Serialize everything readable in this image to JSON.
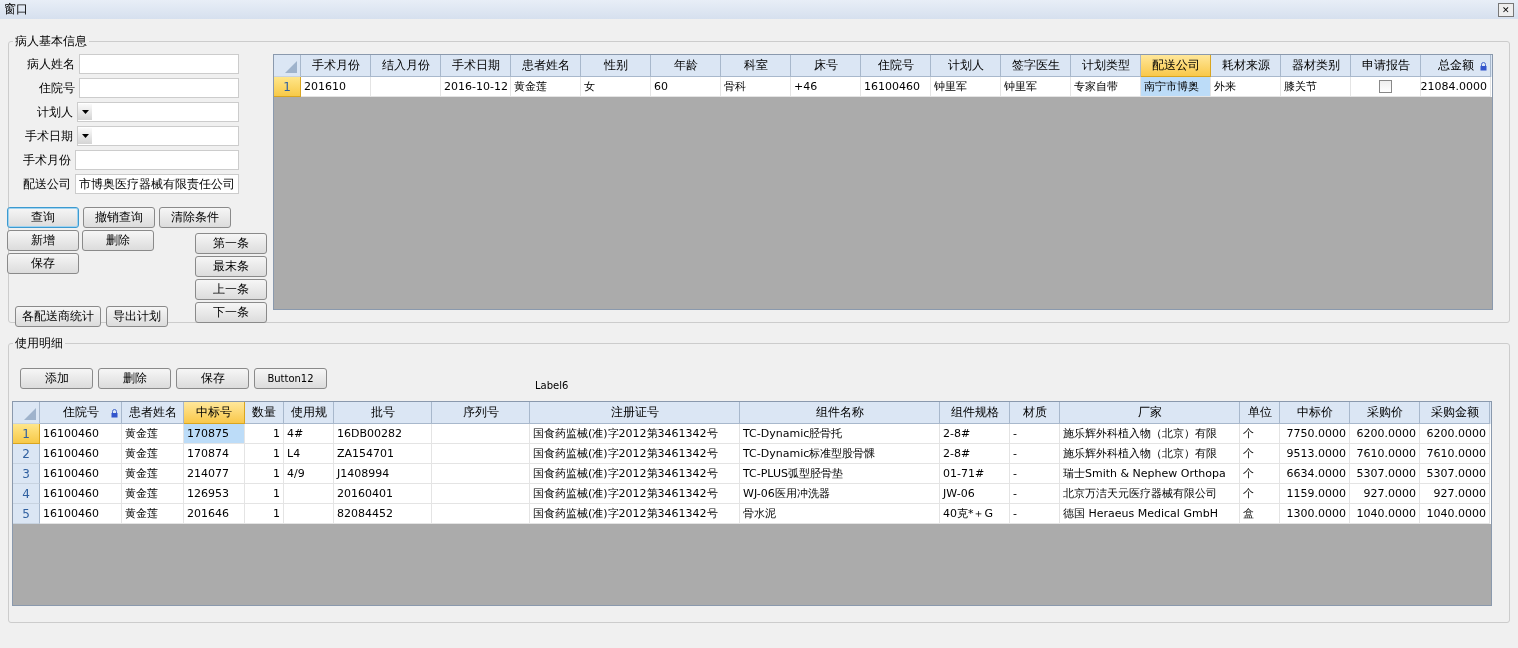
{
  "window": {
    "title": "窗口",
    "close": "✕"
  },
  "patient_group": {
    "title": "病人基本信息",
    "fields": [
      {
        "label": "病人姓名",
        "kind": "text"
      },
      {
        "label": "住院号",
        "kind": "text"
      },
      {
        "label": "计划人",
        "kind": "dropdown"
      },
      {
        "label": "手术日期",
        "kind": "dropdown"
      },
      {
        "label": "手术月份",
        "kind": "text"
      },
      {
        "label": "配送公司",
        "kind": "text",
        "value": "市博奥医疗器械有限责任公司"
      }
    ],
    "action_buttons": [
      {
        "label": "查询",
        "focused": true
      },
      {
        "label": "撤销查询",
        "focused": false
      },
      {
        "label": "清除条件",
        "focused": false
      }
    ],
    "edit_buttons": [
      [
        "新增",
        "删除"
      ],
      [
        "保存"
      ]
    ],
    "nav_buttons": [
      "第一条",
      "最末条",
      "上一条",
      "下一条"
    ],
    "report_buttons": [
      "各配送商统计",
      "导出计划"
    ],
    "grid": {
      "columns": [
        {
          "label": "手术月份",
          "kind": "text",
          "selected": false,
          "locked": false
        },
        {
          "label": "结入月份",
          "kind": "text",
          "selected": false,
          "locked": false
        },
        {
          "label": "手术日期",
          "kind": "text",
          "selected": false,
          "locked": false
        },
        {
          "label": "患者姓名",
          "kind": "text",
          "selected": false,
          "locked": false
        },
        {
          "label": "性别",
          "kind": "text",
          "selected": false,
          "locked": false
        },
        {
          "label": "年龄",
          "kind": "text",
          "selected": false,
          "locked": false
        },
        {
          "label": "科室",
          "kind": "text",
          "selected": false,
          "locked": false
        },
        {
          "label": "床号",
          "kind": "text",
          "selected": false,
          "locked": false
        },
        {
          "label": "住院号",
          "kind": "text",
          "selected": false,
          "locked": false
        },
        {
          "label": "计划人",
          "kind": "text",
          "selected": false,
          "locked": false
        },
        {
          "label": "签字医生",
          "kind": "text",
          "selected": false,
          "locked": false
        },
        {
          "label": "计划类型",
          "kind": "text",
          "selected": false,
          "locked": false
        },
        {
          "label": "配送公司",
          "kind": "text",
          "selected": true,
          "locked": false
        },
        {
          "label": "耗材来源",
          "kind": "text",
          "selected": false,
          "locked": false
        },
        {
          "label": "器材类别",
          "kind": "text",
          "selected": false,
          "locked": false
        },
        {
          "label": "申请报告",
          "kind": "checkbox",
          "selected": false,
          "locked": false
        },
        {
          "label": "总金额",
          "kind": "number",
          "selected": false,
          "locked": true
        }
      ],
      "rows": [
        {
          "number": "1",
          "selected": true,
          "cells": [
            "201610",
            "",
            "2016-10-12",
            "黄金莲",
            "女",
            "60",
            "骨科",
            "+46",
            "16100460",
            "钟里军",
            "钟里军",
            "专家自带",
            "南宁市博奥",
            "外来",
            "膝关节",
            false,
            "21084.0000"
          ]
        }
      ]
    }
  },
  "detail_group": {
    "title": "使用明细",
    "buttons": [
      "添加",
      "删除",
      "保存",
      "Button12"
    ],
    "label": "Label6",
    "grid": {
      "columns": [
        {
          "label": "住院号",
          "kind": "text",
          "selected": false,
          "locked": true
        },
        {
          "label": "患者姓名",
          "kind": "text",
          "selected": false,
          "locked": false
        },
        {
          "label": "中标号",
          "kind": "text",
          "selected": true,
          "locked": false
        },
        {
          "label": "数量",
          "kind": "number",
          "selected": false,
          "locked": false
        },
        {
          "label": "使用规",
          "kind": "text",
          "selected": false,
          "locked": false
        },
        {
          "label": "批号",
          "kind": "text",
          "selected": false,
          "locked": false
        },
        {
          "label": "序列号",
          "kind": "text",
          "selected": false,
          "locked": false
        },
        {
          "label": "注册证号",
          "kind": "text",
          "selected": false,
          "locked": false
        },
        {
          "label": "组件名称",
          "kind": "text",
          "selected": false,
          "locked": false
        },
        {
          "label": "组件规格",
          "kind": "text",
          "selected": false,
          "locked": false
        },
        {
          "label": "材质",
          "kind": "text",
          "selected": false,
          "locked": false
        },
        {
          "label": "厂家",
          "kind": "text",
          "selected": false,
          "locked": false
        },
        {
          "label": "单位",
          "kind": "text",
          "selected": false,
          "locked": false
        },
        {
          "label": "中标价",
          "kind": "number",
          "selected": false,
          "locked": false
        },
        {
          "label": "采购价",
          "kind": "number",
          "selected": false,
          "locked": false
        },
        {
          "label": "采购金额",
          "kind": "number",
          "selected": false,
          "locked": false
        }
      ],
      "rows": [
        {
          "number": "1",
          "selected": true,
          "cells": [
            "16100460",
            "黄金莲",
            "170875",
            "1",
            "4#",
            "16DB00282",
            "",
            "国食药监械(准)字2012第3461342号",
            "TC-Dynamic胫骨托",
            "2-8#",
            "-",
            "施乐辉外科植入物（北京）有限",
            "个",
            "7750.0000",
            "6200.0000",
            "6200.0000"
          ]
        },
        {
          "number": "2",
          "selected": false,
          "cells": [
            "16100460",
            "黄金莲",
            "170874",
            "1",
            "L4",
            "ZA154701",
            "",
            "国食药监械(准)字2012第3461342号",
            "TC-Dynamic标准型股骨髁",
            "2-8#",
            "-",
            "施乐辉外科植入物（北京）有限",
            "个",
            "9513.0000",
            "7610.0000",
            "7610.0000"
          ]
        },
        {
          "number": "3",
          "selected": false,
          "cells": [
            "16100460",
            "黄金莲",
            "214077",
            "1",
            "4/9",
            "J1408994",
            "",
            "国食药监械(准)字2012第3461342号",
            "TC-PLUS弧型胫骨垫",
            "01-71#",
            "-",
            "瑞士Smith & Nephew Orthopa",
            "个",
            "6634.0000",
            "5307.0000",
            "5307.0000"
          ]
        },
        {
          "number": "4",
          "selected": false,
          "cells": [
            "16100460",
            "黄金莲",
            "126953",
            "1",
            "",
            "20160401",
            "",
            "国食药监械(准)字2012第3461342号",
            "WJ-06医用冲洗器",
            "JW-06",
            "-",
            "北京万洁天元医疗器械有限公司",
            "个",
            "1159.0000",
            "927.0000",
            "927.0000"
          ]
        },
        {
          "number": "5",
          "selected": false,
          "cells": [
            "16100460",
            "黄金莲",
            "201646",
            "1",
            "",
            "82084452",
            "",
            "国食药监械(准)字2012第3461342号",
            "骨水泥",
            "40克*＋G",
            "-",
            "德国 Heraeus Medical GmbH",
            "盒",
            "1300.0000",
            "1040.0000",
            "1040.0000"
          ]
        }
      ]
    }
  }
}
